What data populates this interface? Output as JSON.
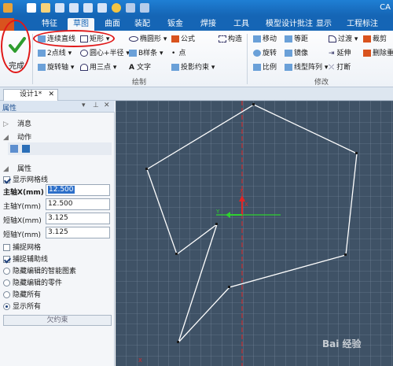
{
  "app": {
    "title_fragment": "CA"
  },
  "ribbon_tabs": [
    "特征",
    "草图",
    "曲面",
    "装配",
    "钣金",
    "焊接",
    "工具",
    "模型设计批注",
    "显示",
    "工程标注"
  ],
  "ribbon": {
    "done_label": "完成",
    "draw_items": {
      "polyline": "连续直线",
      "rect": "矩形",
      "line2": "2点线",
      "circle": "圆心+半径",
      "arc": "用三点",
      "spline": "B样条",
      "rotate_arc": "旋转轴",
      "ellipse": "椭圆形",
      "formula": "公式",
      "text": "文字",
      "point": "点",
      "proj": "投影约束",
      "construct": "构造"
    },
    "modify_items": {
      "move": "移动",
      "offset": "等距",
      "rotate": "旋转",
      "mirror": "镜像",
      "scale": "比例",
      "linear": "线型阵列",
      "fillet": "过渡",
      "trim": "裁剪",
      "extend": "延伸",
      "delete": "删除重",
      "break": "打断"
    },
    "group_draw": "绘制",
    "group_modify": "修改"
  },
  "doc_tab": "设计1*",
  "panel": {
    "title": "属性",
    "pin": "▾ ✕",
    "sections": {
      "messages": "消息",
      "actions": "动作",
      "properties": "属性"
    },
    "show_grid": "显示网格线",
    "fields": [
      {
        "label": "主轴X(mm)",
        "value": "12.500",
        "bold": true,
        "selected": true
      },
      {
        "label": "主轴Y(mm)",
        "value": "12.500",
        "bold": false,
        "selected": false
      },
      {
        "label": "短轴X(mm)",
        "value": "3.125",
        "bold": false,
        "selected": false
      },
      {
        "label": "短轴Y(mm)",
        "value": "3.125",
        "bold": false,
        "selected": false
      }
    ],
    "snap_grid": "捕捉网格",
    "snap_aux": "捕捉辅助线",
    "radios": [
      "隐藏编辑的智能图素",
      "隐藏编辑的零件",
      "隐藏所有",
      "显示所有"
    ],
    "constraint": "欠约束"
  },
  "canvas": {
    "axis_x_label": "X",
    "axis_x_tag": "X",
    "axis_y_tag": "Y",
    "axis_bottom_tag": "X",
    "watermark": "Bai 经验"
  },
  "colors": {
    "titlebar": "#1565b5",
    "grid_bg": "#3f5266",
    "highlight": "#e01818",
    "polyline": "#ffffff"
  }
}
